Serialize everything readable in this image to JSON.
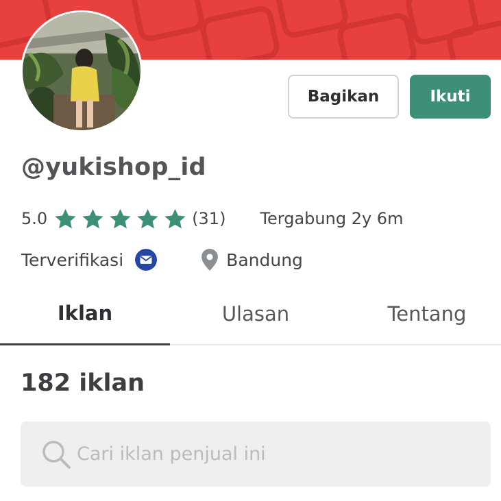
{
  "profile": {
    "username": "@yukishop_id",
    "rating_value": "5.0",
    "star_count": 5,
    "rating_count": "(31)",
    "joined": "Tergabung 2y 6m",
    "verified_label": "Terverifikasi",
    "location": "Bandung",
    "avatar_icon": "profile-photo"
  },
  "actions": {
    "share_label": "Bagikan",
    "follow_label": "Ikuti"
  },
  "tabs": [
    {
      "label": "Iklan",
      "active": true
    },
    {
      "label": "Ulasan",
      "active": false
    },
    {
      "label": "Tentang",
      "active": false
    }
  ],
  "listing": {
    "count_label": "182 iklan"
  },
  "search": {
    "placeholder": "Cari iklan penjual ini",
    "value": ""
  },
  "colors": {
    "banner": "#e8403c",
    "accent": "#3d8f77",
    "star": "#3d8f77",
    "verified_badge": "#2447a6",
    "location_pin": "#8b8e92"
  }
}
